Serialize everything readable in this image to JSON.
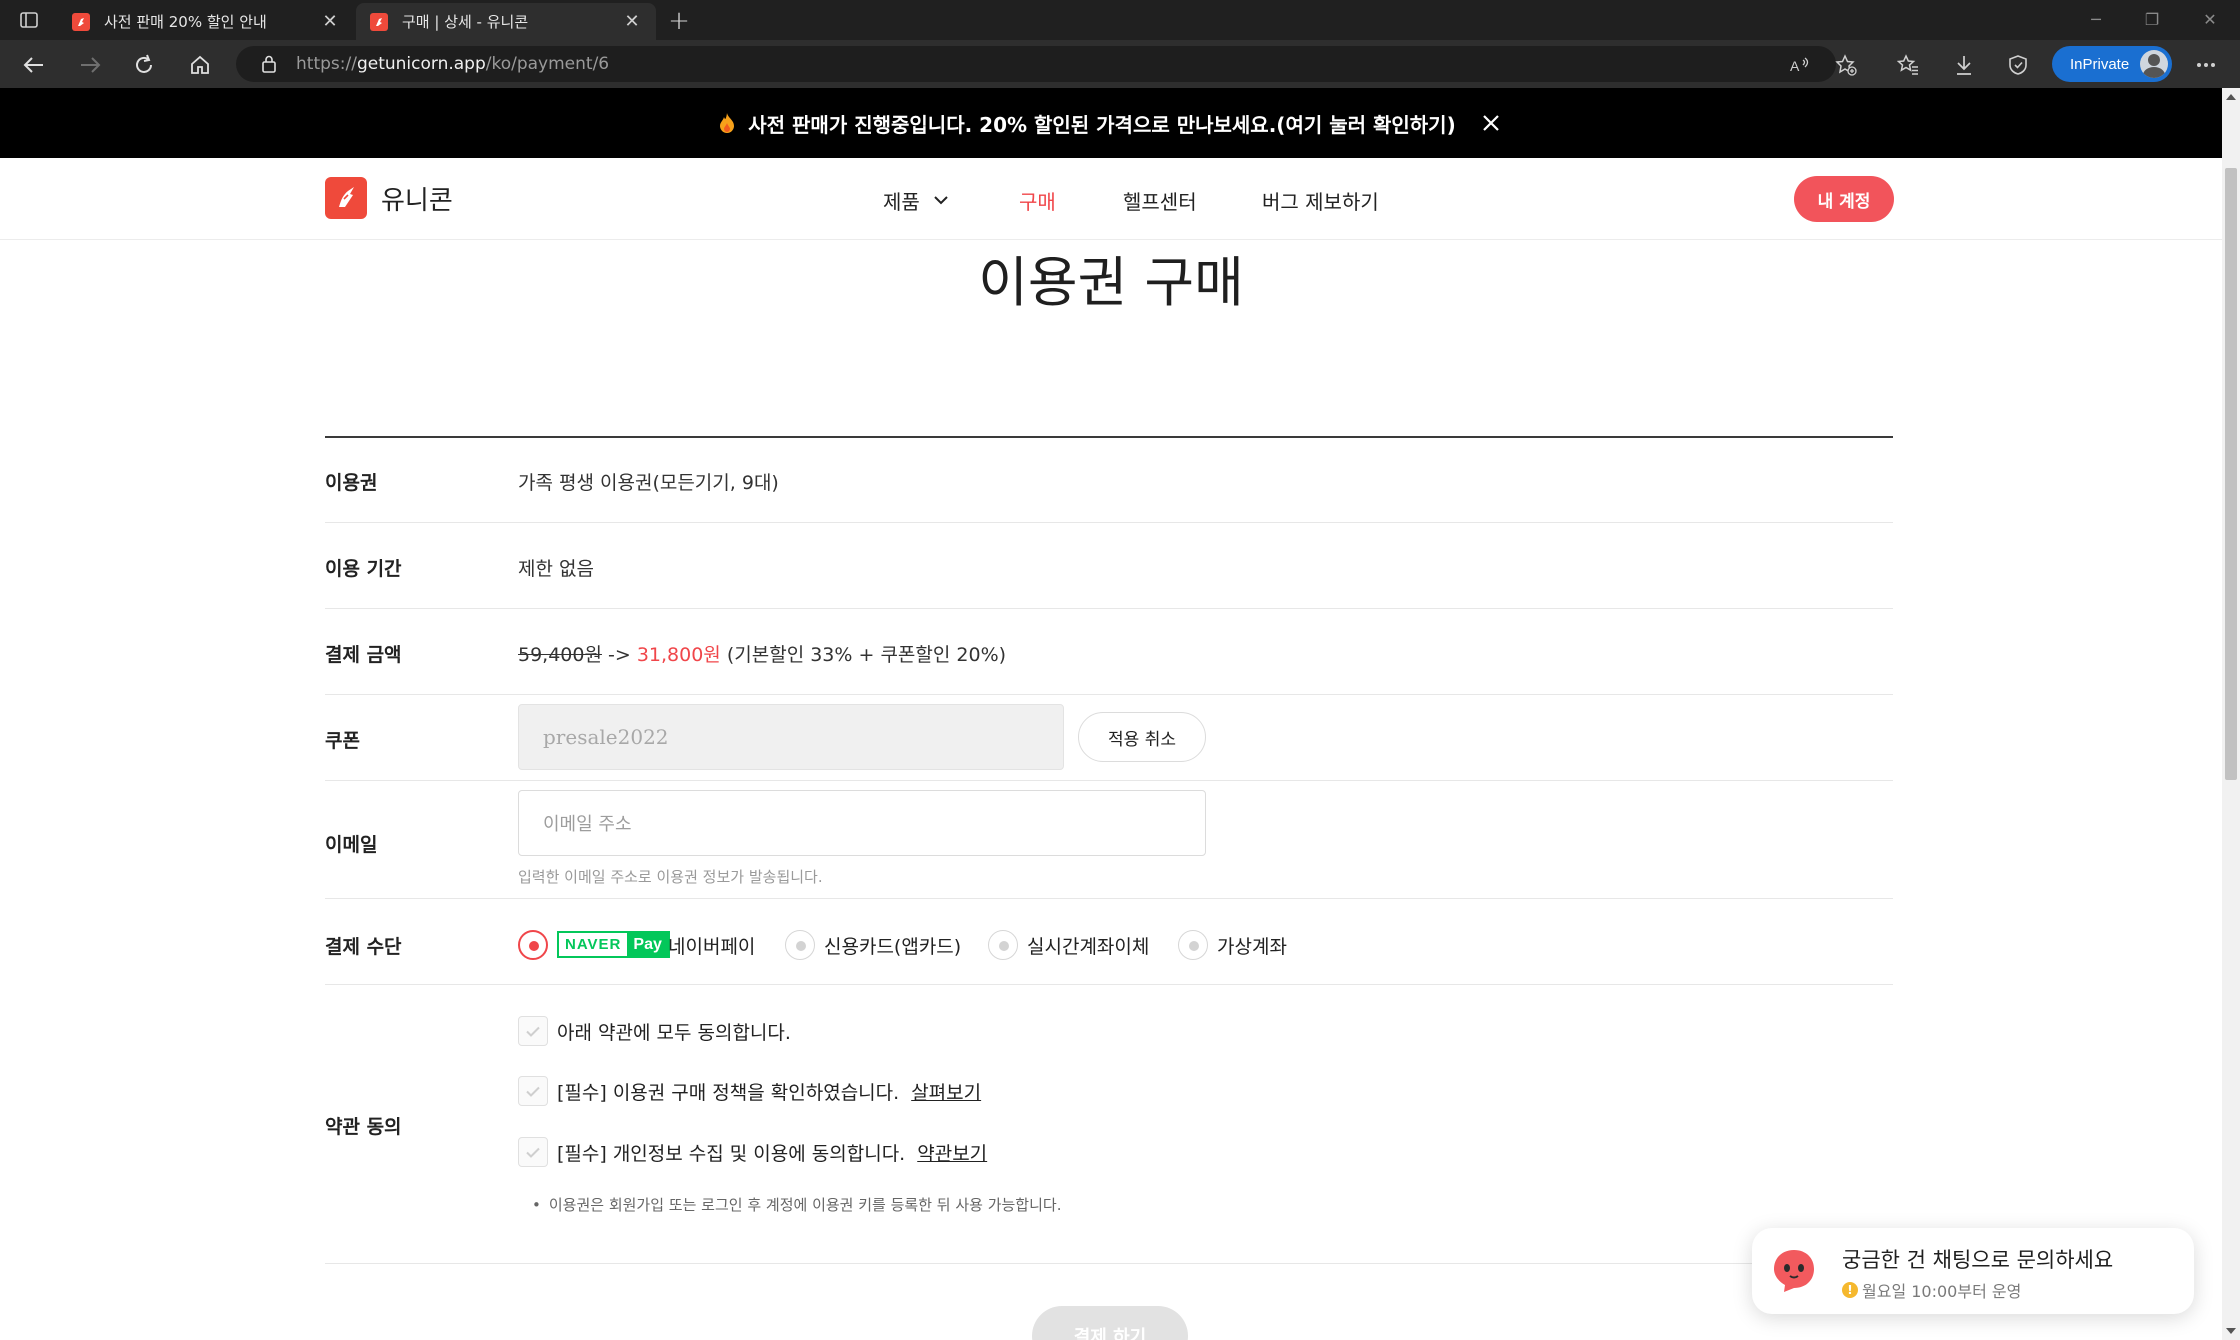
{
  "browser": {
    "tabs": [
      {
        "title": "사전 판매 20% 할인 안내",
        "active": false
      },
      {
        "title": "구매 | 상세 - 유니콘",
        "active": true
      }
    ],
    "url_scheme": "https://",
    "url_host": "getunicorn.app",
    "url_path": "/ko/payment/6",
    "inprivate_label": "InPrivate"
  },
  "promo": {
    "text": "사전 판매가 진행중입니다. 20% 할인된 가격으로 만나보세요.(여기 눌러 확인하기)"
  },
  "header": {
    "logo_text": "유니콘",
    "menu": {
      "products": "제품",
      "purchase": "구매",
      "help": "헬프센터",
      "bug": "버그 제보하기"
    },
    "account_button": "내 계정"
  },
  "page": {
    "title": "이용권 구매"
  },
  "form": {
    "plan_label": "이용권",
    "plan_value": "가족 평생 이용권(모든기기, 9대)",
    "period_label": "이용 기간",
    "period_value": "제한 없음",
    "price_label": "결제 금액",
    "price_original": "59,400원",
    "price_arrow": " -> ",
    "price_final": "31,800원",
    "price_discount": " (기본할인 33% + 쿠폰할인 20%)",
    "coupon_label": "쿠폰",
    "coupon_value": "presale2022",
    "coupon_cancel": "적용 취소",
    "email_label": "이메일",
    "email_placeholder": "이메일 주소",
    "email_help": "입력한 이메일 주소로 이용권 정보가 발송됩니다.",
    "payment_label": "결제 수단",
    "payment_methods": {
      "naver_badge_left": "NAVER",
      "naver_badge_right": "Pay",
      "naver": "네이버페이",
      "card": "신용카드(앱카드)",
      "transfer": "실시간계좌이체",
      "virtual": "가상계좌"
    },
    "terms_label": "약관 동의",
    "terms": {
      "all": "아래 약관에 모두 동의합니다.",
      "policy": "[필수] 이용권 구매 정책을 확인하였습니다.",
      "privacy": "[필수] 개인정보 수집 및 이용에 동의합니다.",
      "view1": "살펴보기",
      "view2": "약관보기"
    },
    "note": "이용권은 회원가입 또는 로그인 후 계정에 이용권 키를 등록한 뒤 사용 가능합니다.",
    "submit": "결제 하기"
  },
  "chat": {
    "title": "궁금한 건 채팅으로 문의하세요",
    "hours": "월요일 10:00부터 운영"
  },
  "colors": {
    "accent": "#f0464a",
    "naver": "#03c75a"
  }
}
